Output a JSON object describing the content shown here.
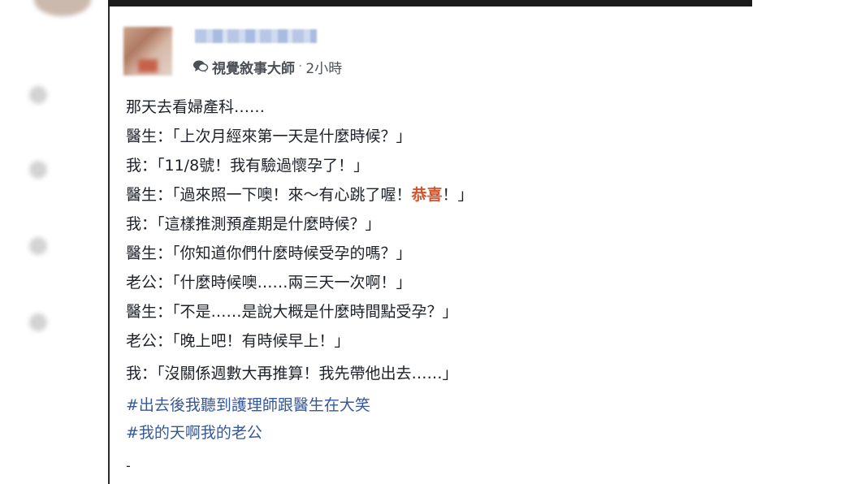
{
  "post": {
    "page_icon": "speech-bubbles-icon",
    "page_name": "視覺敘事大師",
    "separator": "·",
    "time": "2小時",
    "lines": [
      {
        "pre": "那天去看婦產科……",
        "hl": "",
        "post": ""
      },
      {
        "pre": "醫生：「上次月經來第一天是什麼時候？」",
        "hl": "",
        "post": ""
      },
      {
        "pre": "我：「11/8號！我有驗過懷孕了！」",
        "hl": "",
        "post": ""
      },
      {
        "pre": "醫生：「過來照一下噢！來～有心跳了喔！",
        "hl": "恭喜",
        "post": "！」"
      },
      {
        "pre": "我：「這樣推測預產期是什麼時候？」",
        "hl": "",
        "post": ""
      },
      {
        "pre": "醫生：「你知道你們什麼時候受孕的嗎？」",
        "hl": "",
        "post": ""
      },
      {
        "pre": "老公：「什麼時候噢……兩三天一次啊！」",
        "hl": "",
        "post": ""
      },
      {
        "pre": "醫生：「不是……是說大概是什麼時間點受孕？」",
        "hl": "",
        "post": ""
      },
      {
        "pre": "老公：「晚上吧！有時候早上！」",
        "hl": "",
        "post": ""
      },
      {
        "pre": "我：「沒關係週數大再推算！我先帶他出去……」",
        "hl": "",
        "post": ""
      }
    ],
    "hashtags": [
      "#出去後我聽到護理師跟醫生在大笑",
      "#我的天啊我的老公"
    ],
    "trailing": "-"
  },
  "colors": {
    "text": "#1d2129",
    "highlight": "#d2532f",
    "hashtag": "#365899",
    "meta": "#4b4f56"
  }
}
